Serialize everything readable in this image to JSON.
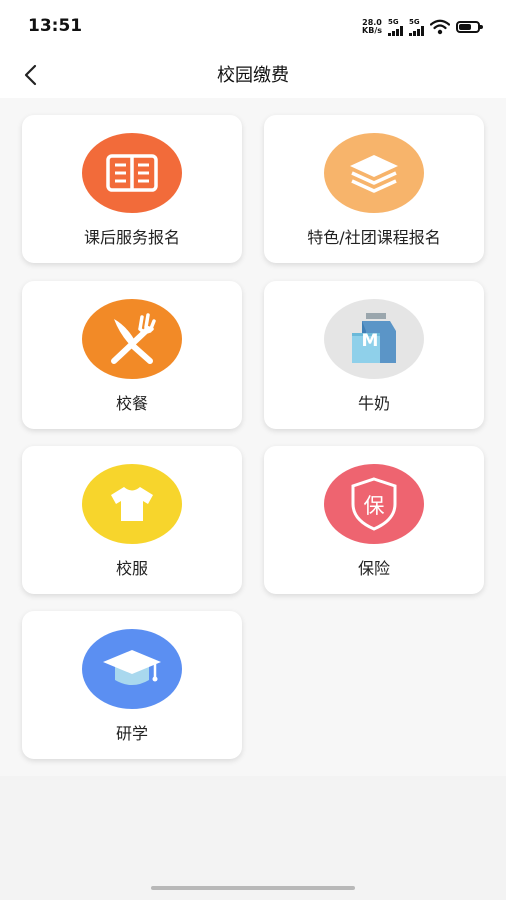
{
  "status_bar": {
    "time": "13:51",
    "net_speed_value": "28.0",
    "net_speed_unit": "KB/s",
    "signal1_label": "5G",
    "signal2_label": "5G"
  },
  "header": {
    "title": "校园缴费"
  },
  "menu": {
    "items": [
      {
        "label": "课后服务报名",
        "icon": "book-icon",
        "color": "#f26b3a"
      },
      {
        "label": "特色/社团课程报名",
        "icon": "layers-icon",
        "color": "#f7b46b"
      },
      {
        "label": "校餐",
        "icon": "knife-fork-icon",
        "color": "#f28a27"
      },
      {
        "label": "牛奶",
        "icon": "milk-carton-icon",
        "color": "#e5e5e5",
        "letter": "M"
      },
      {
        "label": "校服",
        "icon": "tshirt-icon",
        "color": "#f7d52c"
      },
      {
        "label": "保险",
        "icon": "insurance-shield-icon",
        "color": "#ee6470",
        "letter": "保"
      },
      {
        "label": "研学",
        "icon": "graduation-cap-icon",
        "color": "#5b8ff2"
      }
    ]
  }
}
